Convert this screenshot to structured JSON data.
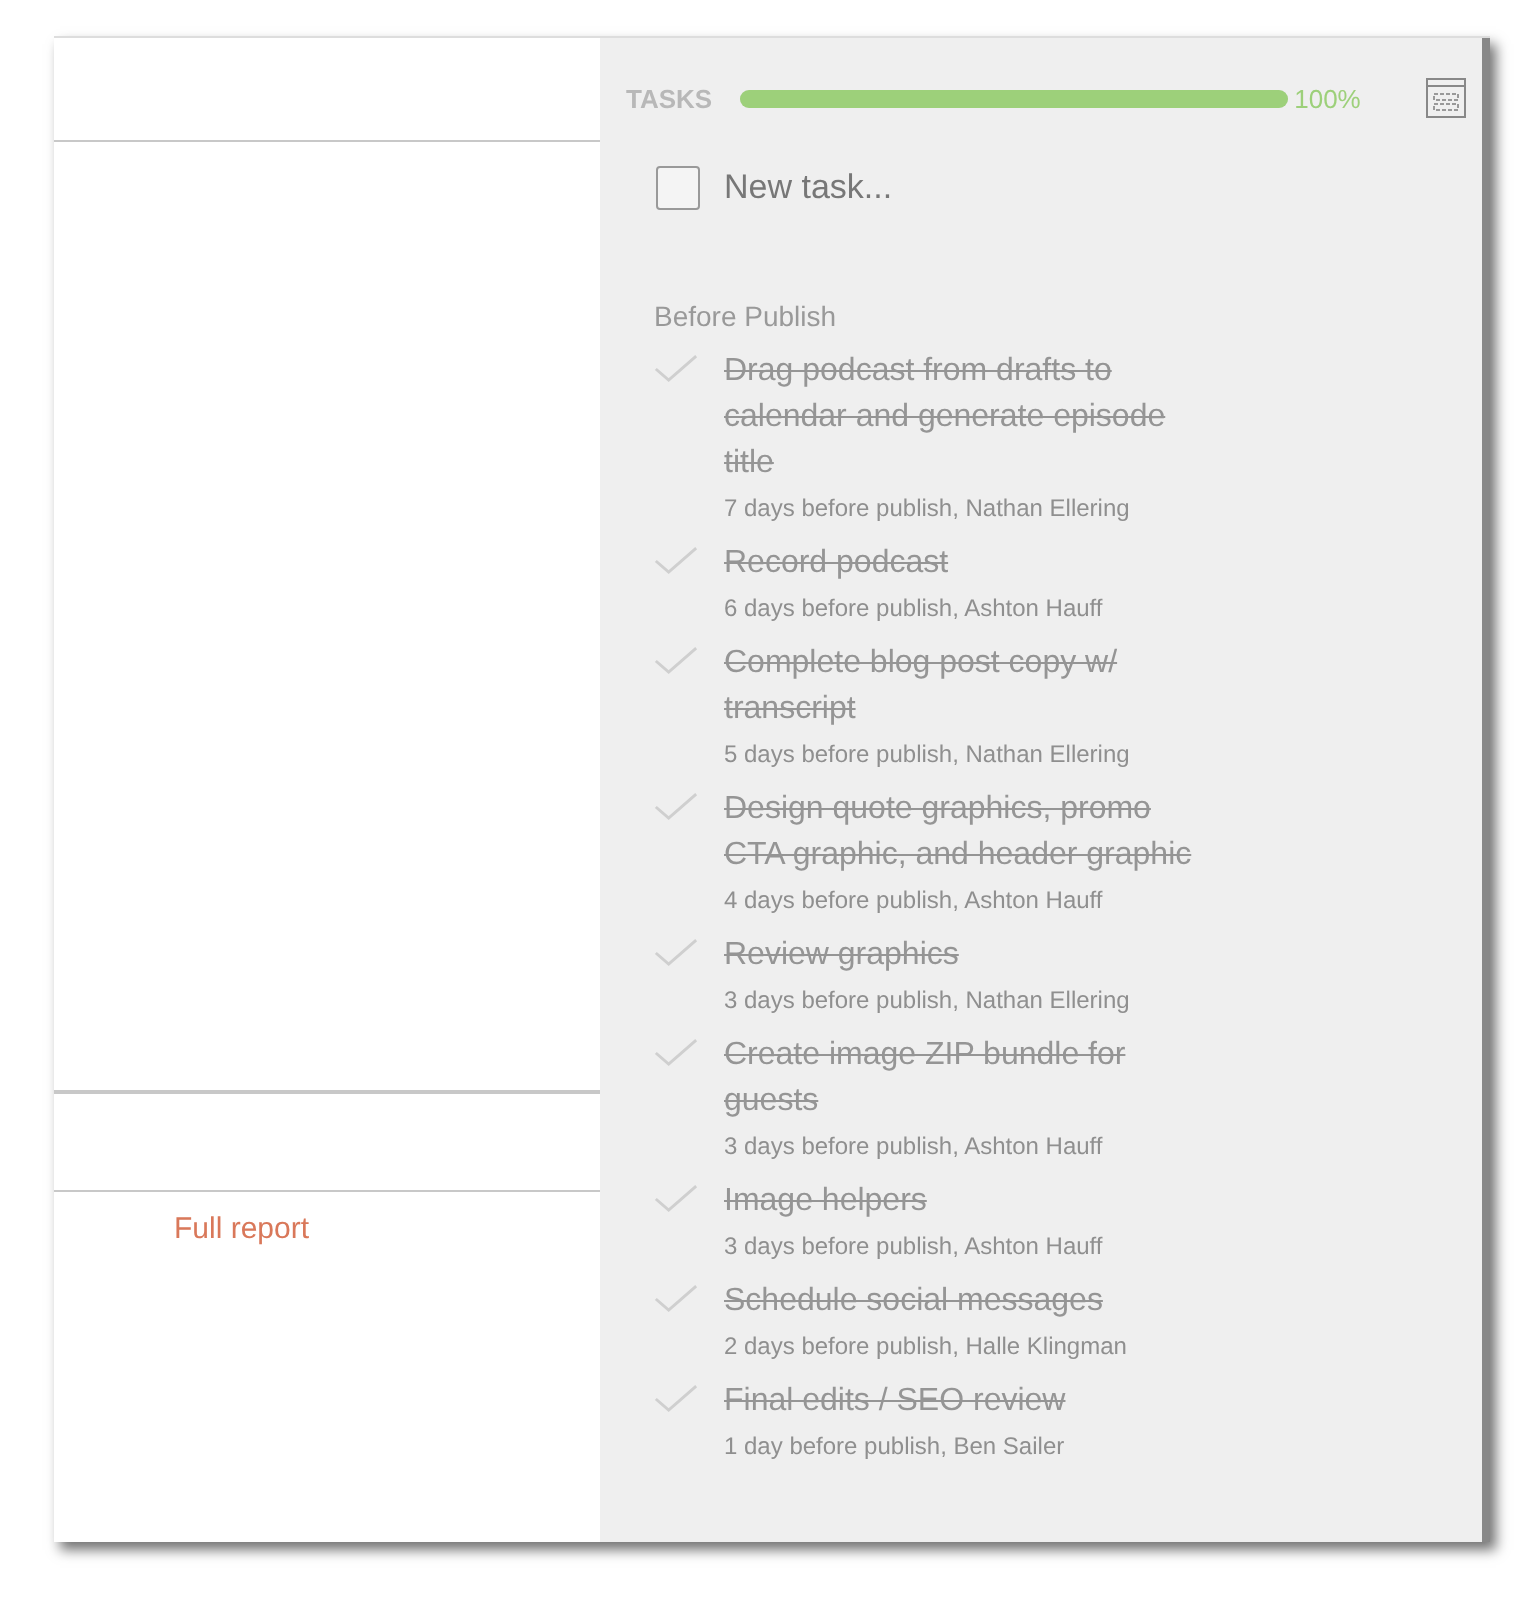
{
  "left_panel": {
    "link": "Full report"
  },
  "tasks_panel": {
    "title": "TASKS",
    "progress": {
      "level": 1.0,
      "label": "100%"
    },
    "new_task": {
      "placeholder": "New task...",
      "checked": false
    },
    "group": "Before Publish",
    "tasks": [
      {
        "title": "Drag podcast from drafts to calendar and generate episode title",
        "meta": "7 days before publish, Nathan Ellering",
        "done": true
      },
      {
        "title": "Record podcast",
        "meta": "6 days before publish, Ashton Hauff",
        "done": true
      },
      {
        "title": "Complete blog post copy w/ transcript",
        "meta": "5 days before publish, Nathan Ellering",
        "done": true
      },
      {
        "title": "Design quote graphics, promo CTA graphic, and header graphic",
        "meta": "4 days before publish, Ashton Hauff",
        "done": true
      },
      {
        "title": "Review graphics",
        "meta": "3 days before publish, Nathan Ellering",
        "done": true
      },
      {
        "title": "Create image ZIP bundle for guests",
        "meta": "3 days before publish, Ashton Hauff",
        "done": true
      },
      {
        "title": "Image helpers",
        "meta": "3 days before publish, Ashton Hauff",
        "done": true
      },
      {
        "title": "Schedule social messages",
        "meta": "2 days before publish, Halle Klingman",
        "done": true
      },
      {
        "title": "Final edits / SEO review",
        "meta": "1 day before publish, Ben Sailer",
        "done": true
      }
    ]
  }
}
